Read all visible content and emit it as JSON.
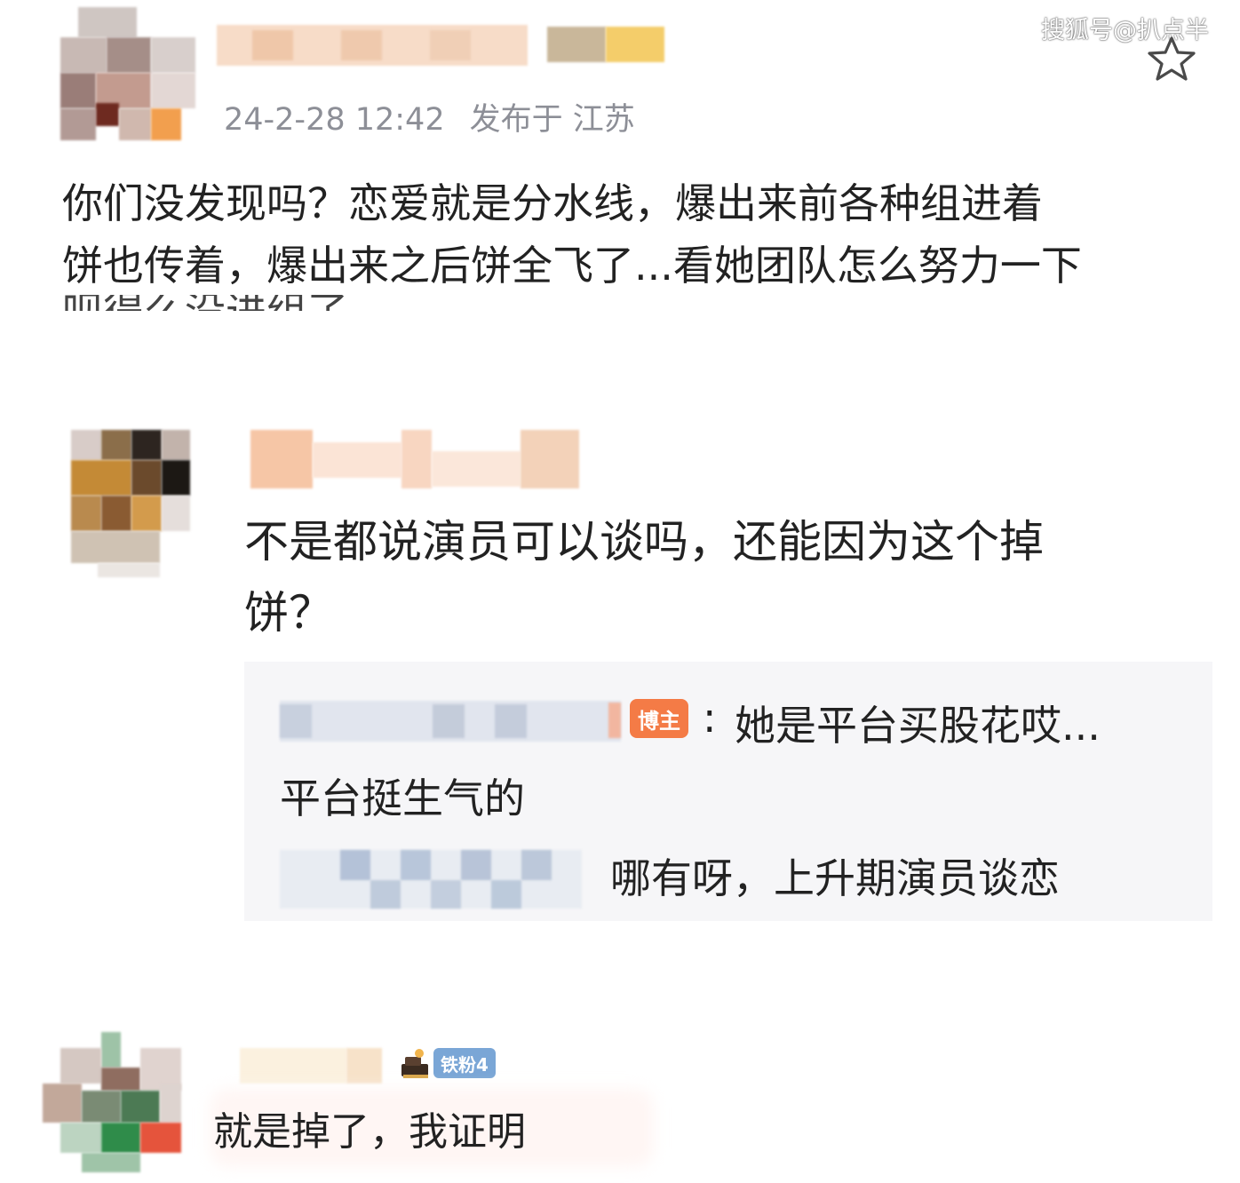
{
  "watermark": "搜狐号@扒点半",
  "icons": {
    "favorite": "star-icon",
    "fan_level": "fan-level-icon"
  },
  "colors": {
    "blogger_badge": "#f47b46",
    "fan_badge": "#7aa6d6",
    "reply_bg": "#f6f6f8",
    "meta_text": "#8d8f97"
  },
  "comment1": {
    "timestamp": "24-2-28 12:42",
    "location": "发布于 江苏",
    "text_line1": "你们没发现吗？恋爱就是分水线，爆出来前各种组进着",
    "text_line2": "饼也传着，爆出来之后饼全飞了...看她团队怎么努力一下",
    "text_line3_cut": "呗得么没进组了"
  },
  "comment2": {
    "text_line1": "不是都说演员可以谈吗，还能因为这个掉",
    "text_line2": "饼？",
    "replies": {
      "reply1_badge": "博主",
      "reply1_text": "她是平台买股花哎...",
      "reply1_text_line2": "平台挺生气的",
      "reply2_text": "哪有呀，上升期演员谈恋"
    }
  },
  "comment3": {
    "fan_badge": "铁粉4",
    "text": "就是掉了，我证明"
  }
}
